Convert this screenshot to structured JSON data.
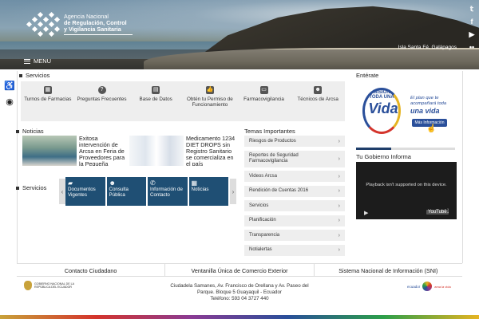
{
  "header": {
    "logo_line1": "Agencia Nacional",
    "logo_line2": "de Regulación, Control",
    "logo_line3": "y Vigilancia Sanitaria",
    "caption": "Isla Santa Fé, Galápagos",
    "menu_label": "MENU",
    "social_icons": [
      "twitter-icon",
      "facebook-icon",
      "youtube-icon",
      "flickr-icon"
    ]
  },
  "servicios": {
    "title": "Servicios",
    "items": [
      {
        "label": "Turnos de Farmacias",
        "icon": "calendar-icon"
      },
      {
        "label": "Preguntas Frecuentes",
        "icon": "question-icon"
      },
      {
        "label": "Base de Datos",
        "icon": "database-icon"
      },
      {
        "label": "Obtén tu Permiso de Funcionamiento",
        "icon": "thumbs-up-icon"
      },
      {
        "label": "Farmacovigilancia",
        "icon": "monitor-icon"
      },
      {
        "label": "Técnicos de Arcsa",
        "icon": "users-icon"
      }
    ]
  },
  "noticias": {
    "title": "Noticias",
    "items": [
      {
        "text": "Exitosa intervención de Arcsa en Feria de Proveedores para la Pequeña Empresa de"
      },
      {
        "text": "Medicamento 1234 DIET DROPS sin Registro Sanitario se comercializa en el país"
      }
    ]
  },
  "temas": {
    "title": "Temas Importantes",
    "items": [
      "Riesgos de Productos",
      "Reportes de Seguridad Farmacovigilancia",
      "Videos Arcsa",
      "Rendición de Cuentas 2016",
      "Servicios",
      "Planificación",
      "Transparencia",
      "Notialertas"
    ]
  },
  "servicios_carousel": {
    "title": "Servicios",
    "items": [
      {
        "label": "Documentos Vigentes",
        "icon": "folder-icon"
      },
      {
        "label": "Consulta Pública",
        "icon": "users-icon"
      },
      {
        "label": "Información de Contacto",
        "icon": "phone-icon"
      },
      {
        "label": "Noticias",
        "icon": "grid-icon"
      }
    ]
  },
  "entrate": {
    "title": "Entérate",
    "mision_top": "MISIÓN TODA UNA",
    "mision_word": "Vida",
    "tagline": "El plan que te acompañará toda",
    "tagline_big": "una vida",
    "button": "Más Información"
  },
  "gobierno": {
    "title": "Tu Gobierno Informa",
    "video_message": "Playback isn't supported on this device.",
    "youtube_label": "YouTube"
  },
  "bottom_links": [
    "Contacto Ciudadano",
    "Ventanilla Única de Comercio Exterior",
    "Sistema Nacional de Información (SNI)"
  ],
  "footer": {
    "gov_label": "GOBIERNO NACIONAL DE LA REPÚBLICA DEL ECUADOR",
    "address_line1": "Ciudadela Samanes, Av. Francisco de Orellana y Av. Paseo del",
    "address_line2": "Parque. Bloque 5 Guayaquil - Ecuador",
    "address_line3": "Teléfono: 593 04 3727 440",
    "ecuador_label": "ecuador",
    "ecuador_slogan": "ama la vida"
  }
}
